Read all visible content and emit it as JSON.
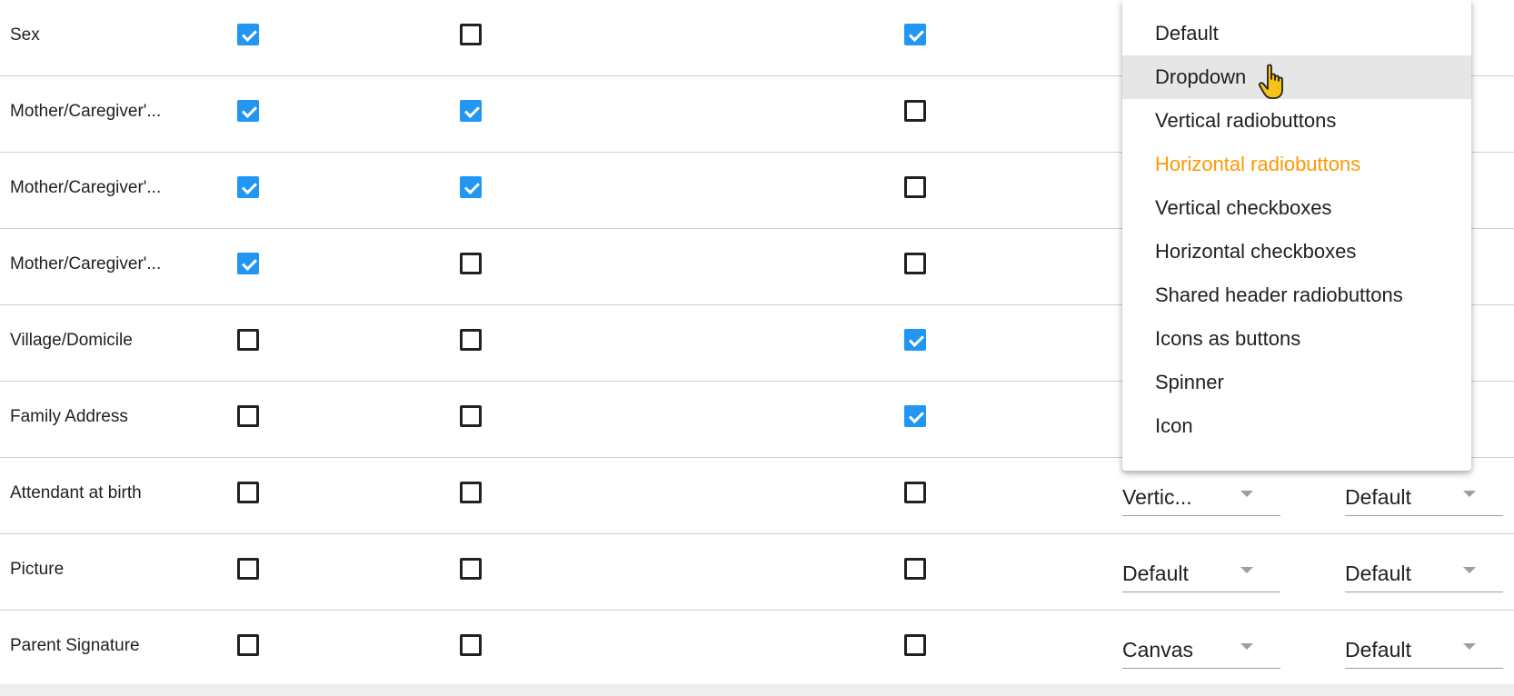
{
  "rows": [
    {
      "label": "Sex",
      "c1": true,
      "c2": false,
      "c3": true,
      "sel1": "",
      "sel2": ""
    },
    {
      "label": "Mother/Caregiver'...",
      "c1": true,
      "c2": true,
      "c3": false,
      "sel1": "",
      "sel2": ""
    },
    {
      "label": "Mother/Caregiver'...",
      "c1": true,
      "c2": true,
      "c3": false,
      "sel1": "",
      "sel2": ""
    },
    {
      "label": "Mother/Caregiver'...",
      "c1": true,
      "c2": false,
      "c3": false,
      "sel1": "",
      "sel2": ""
    },
    {
      "label": "Village/Domicile",
      "c1": false,
      "c2": false,
      "c3": true,
      "sel1": "",
      "sel2": ""
    },
    {
      "label": "Family Address",
      "c1": false,
      "c2": false,
      "c3": true,
      "sel1": "",
      "sel2": ""
    },
    {
      "label": "Attendant at birth",
      "c1": false,
      "c2": false,
      "c3": false,
      "sel1": "Vertic...",
      "sel2": "Default"
    },
    {
      "label": "Picture",
      "c1": false,
      "c2": false,
      "c3": false,
      "sel1": "Default",
      "sel2": "Default"
    },
    {
      "label": "Parent Signature",
      "c1": false,
      "c2": false,
      "c3": false,
      "sel1": "Canvas",
      "sel2": "Default"
    }
  ],
  "menu": {
    "items": [
      "Default",
      "Dropdown",
      "Vertical radiobuttons",
      "Horizontal radiobuttons",
      "Vertical checkboxes",
      "Horizontal checkboxes",
      "Shared header radiobuttons",
      "Icons as buttons",
      "Spinner",
      "Icon"
    ],
    "hovered": "Dropdown",
    "selected": "Horizontal radiobuttons"
  },
  "colors": {
    "checked": "#2196f3",
    "selected_item": "#ff9800",
    "hover_bg": "#e6e6e6"
  },
  "icons": {
    "checkbox": "checkbox-icon",
    "arrow": "dropdown-arrow-icon",
    "cursor": "hand-pointer-cursor-icon"
  }
}
